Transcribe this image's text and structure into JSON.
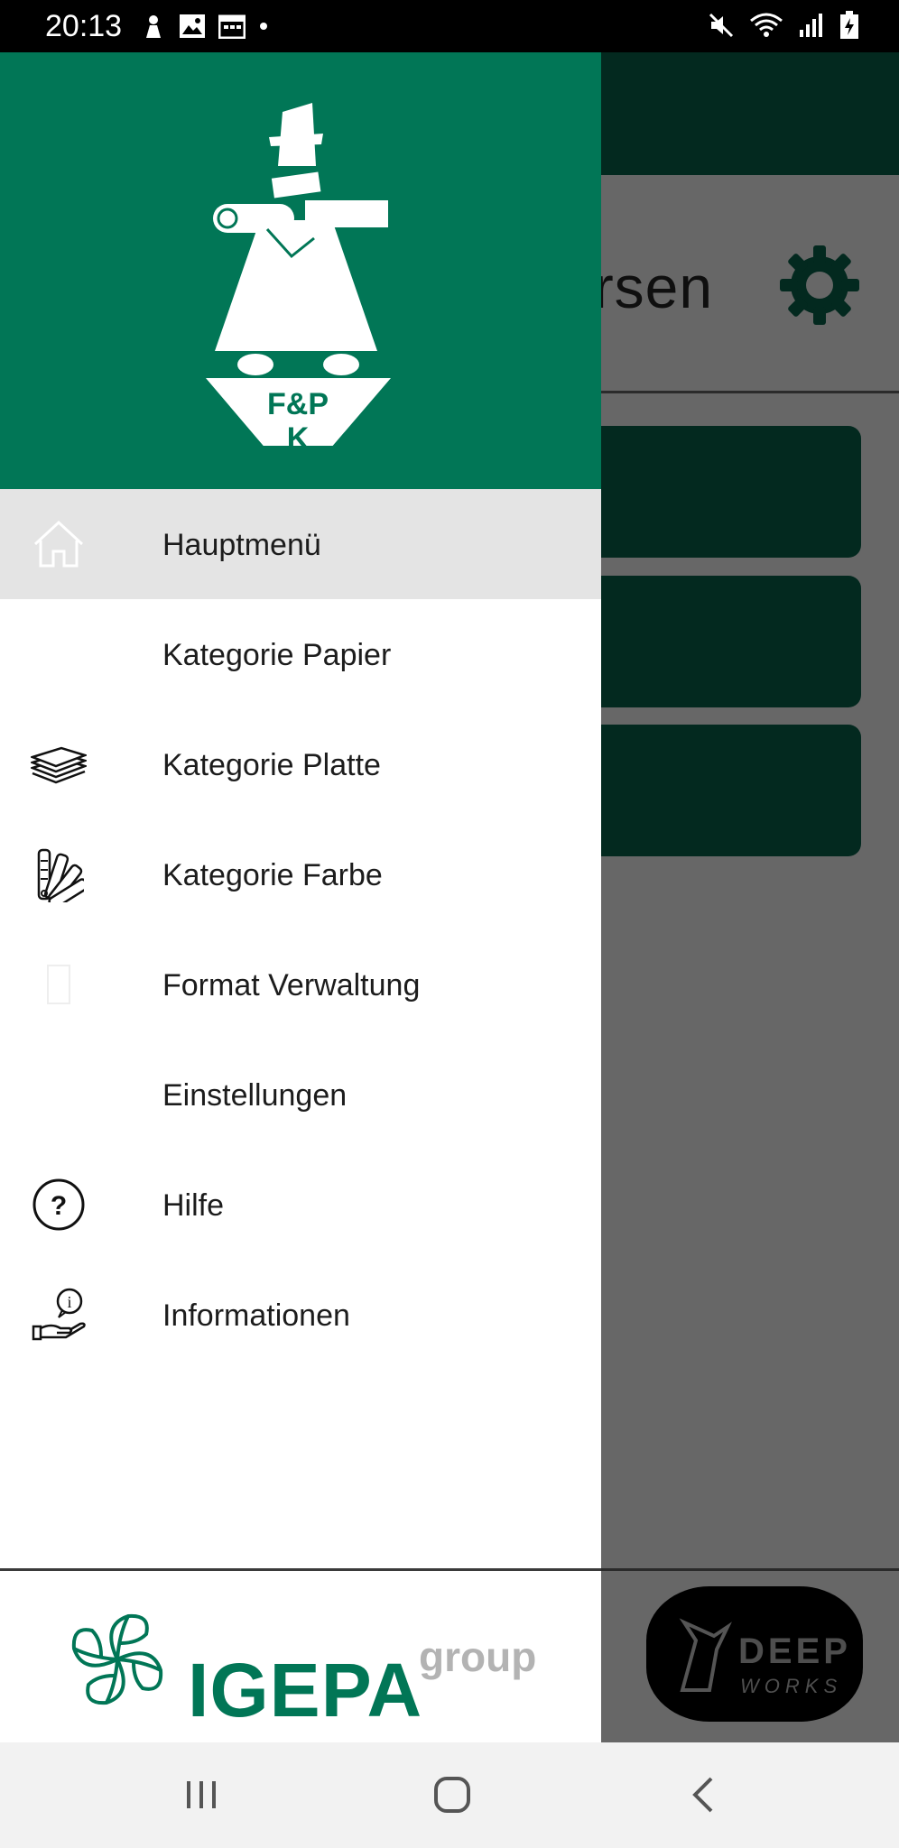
{
  "status_bar": {
    "time": "20:13",
    "left_icons": [
      "notification-icon",
      "gallery-icon",
      "calendar-icon",
      "dot-icon"
    ],
    "right_icons": [
      "mute-icon",
      "wifi-icon",
      "signal-icon",
      "battery-icon"
    ]
  },
  "background_app": {
    "title_fragment": "ersen",
    "settings_icon": "gear-icon"
  },
  "drawer": {
    "brand": {
      "logo": "fpk-logo",
      "logo_text_line1": "F&P",
      "logo_text_line2": "K"
    },
    "items": [
      {
        "label": "Hauptmenü",
        "icon": "home-icon",
        "active": true
      },
      {
        "label": "Kategorie Papier",
        "icon": "none"
      },
      {
        "label": "Kategorie Platte",
        "icon": "stack-icon"
      },
      {
        "label": "Kategorie Farbe",
        "icon": "color-fan-icon"
      },
      {
        "label": "Format Verwaltung",
        "icon": "format-icon"
      },
      {
        "label": "Einstellungen",
        "icon": "none"
      },
      {
        "label": "Hilfe",
        "icon": "help-icon"
      },
      {
        "label": "Informationen",
        "icon": "info-hand-icon"
      }
    ],
    "footer": {
      "brand": "IGEPA",
      "suffix": "group"
    }
  },
  "partner_logo": {
    "line1": "DEEP",
    "line2": "WORKS"
  },
  "colors": {
    "primary": "#017656",
    "dark": "#03291f",
    "scrim": "#676767"
  }
}
